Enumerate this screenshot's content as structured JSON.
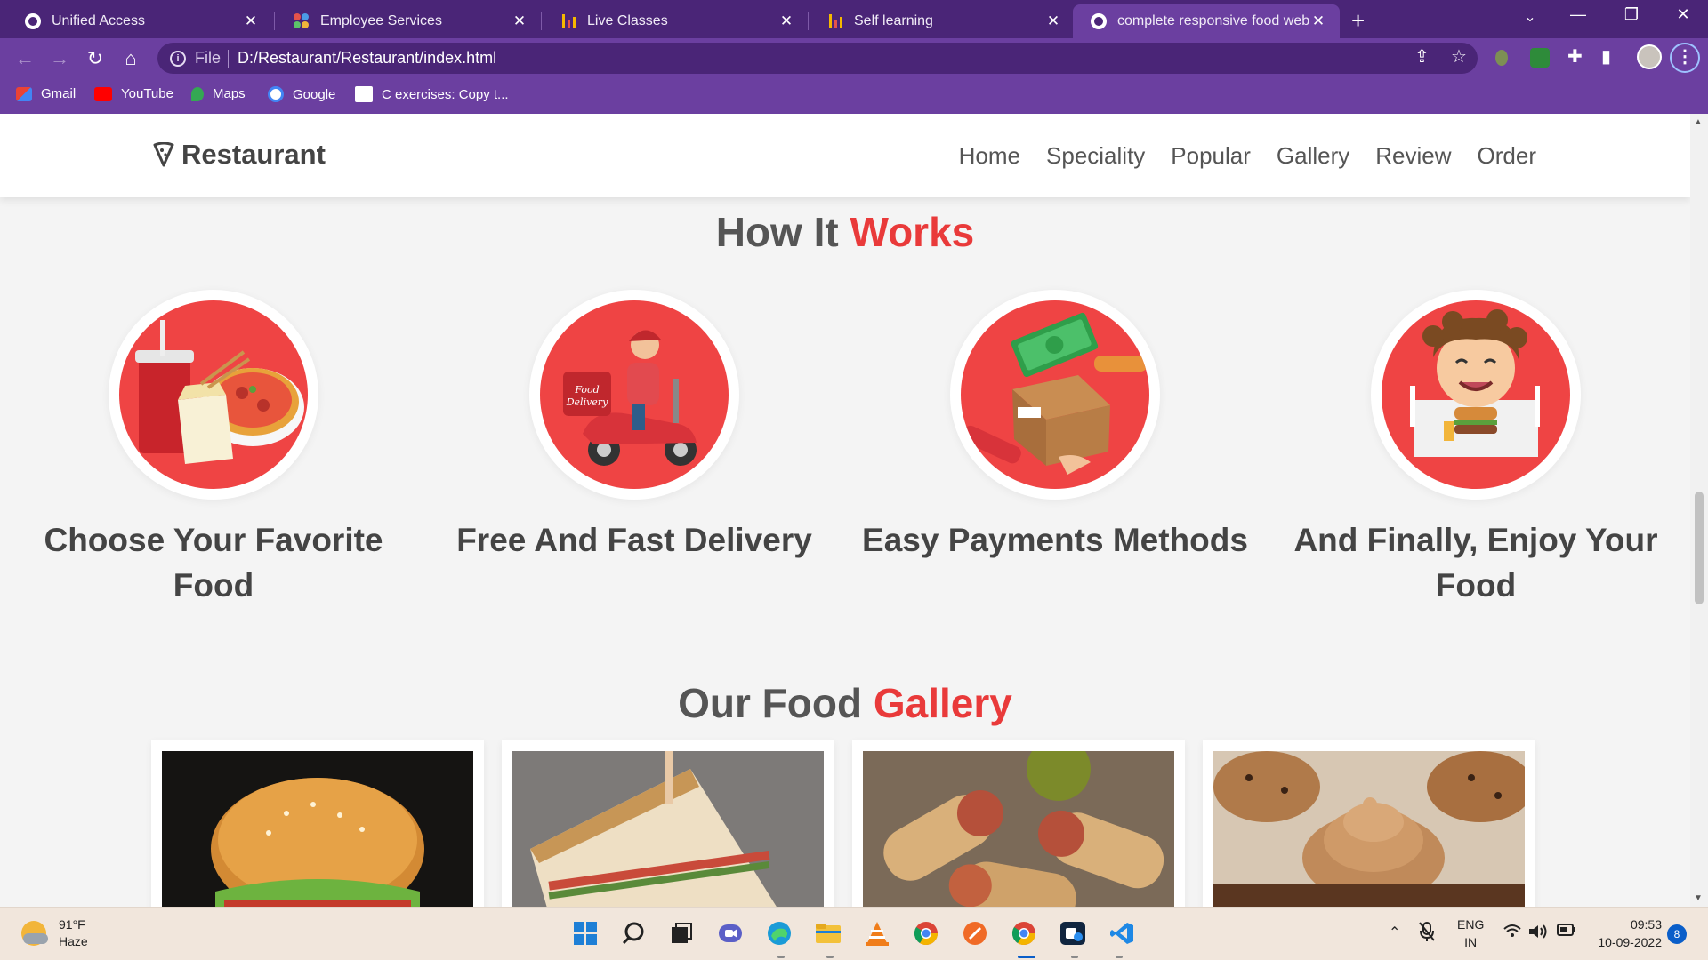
{
  "browser": {
    "tabs": [
      {
        "title": "Unified Access",
        "favicon": "globe-icon",
        "active": false
      },
      {
        "title": "Employee Services",
        "favicon": "dots-icon",
        "active": false
      },
      {
        "title": "Live Classes",
        "favicon": "bars-icon",
        "active": false
      },
      {
        "title": "Self learning",
        "favicon": "bars-icon",
        "active": false
      },
      {
        "title": "complete responsive food websit",
        "favicon": "globe-icon",
        "active": true
      }
    ],
    "address": {
      "scheme_label": "File",
      "url": "D:/Restaurant/Restaurant/index.html"
    },
    "bookmarks": [
      {
        "label": "Gmail",
        "icon": "gmail-icon"
      },
      {
        "label": "YouTube",
        "icon": "youtube-icon"
      },
      {
        "label": "Maps",
        "icon": "maps-icon"
      },
      {
        "label": "Google",
        "icon": "google-icon"
      },
      {
        "label": "C exercises: Copy t...",
        "icon": "w3r-icon"
      }
    ],
    "theme_color": "#6b3fa0"
  },
  "site": {
    "logo_text": "Restaurant",
    "nav": [
      "Home",
      "Speciality",
      "Popular",
      "Gallery",
      "Review",
      "Order"
    ],
    "how_it_works": {
      "title_main": "How It",
      "title_accent": "Works",
      "steps": [
        {
          "label": "Choose Your Favorite Food",
          "illustration": "food-combo-illustration"
        },
        {
          "label": "Free And Fast Delivery",
          "illustration": "delivery-scooter-illustration"
        },
        {
          "label": "Easy Payments Methods",
          "illustration": "payment-package-illustration"
        },
        {
          "label": "And Finally, Enjoy Your Food",
          "illustration": "happy-eater-illustration"
        }
      ]
    },
    "gallery": {
      "title_main": "Our Food",
      "title_accent": "Gallery",
      "photos": [
        "burger-photo",
        "sandwich-photo",
        "wraps-photo",
        "cupcakes-photo"
      ]
    },
    "accent_color": "#e93a3a"
  },
  "taskbar": {
    "weather_temp": "91°F",
    "weather_desc": "Haze",
    "language_top": "ENG",
    "language_bottom": "IN",
    "time": "09:53",
    "date": "10-09-2022",
    "notifications": "8"
  }
}
